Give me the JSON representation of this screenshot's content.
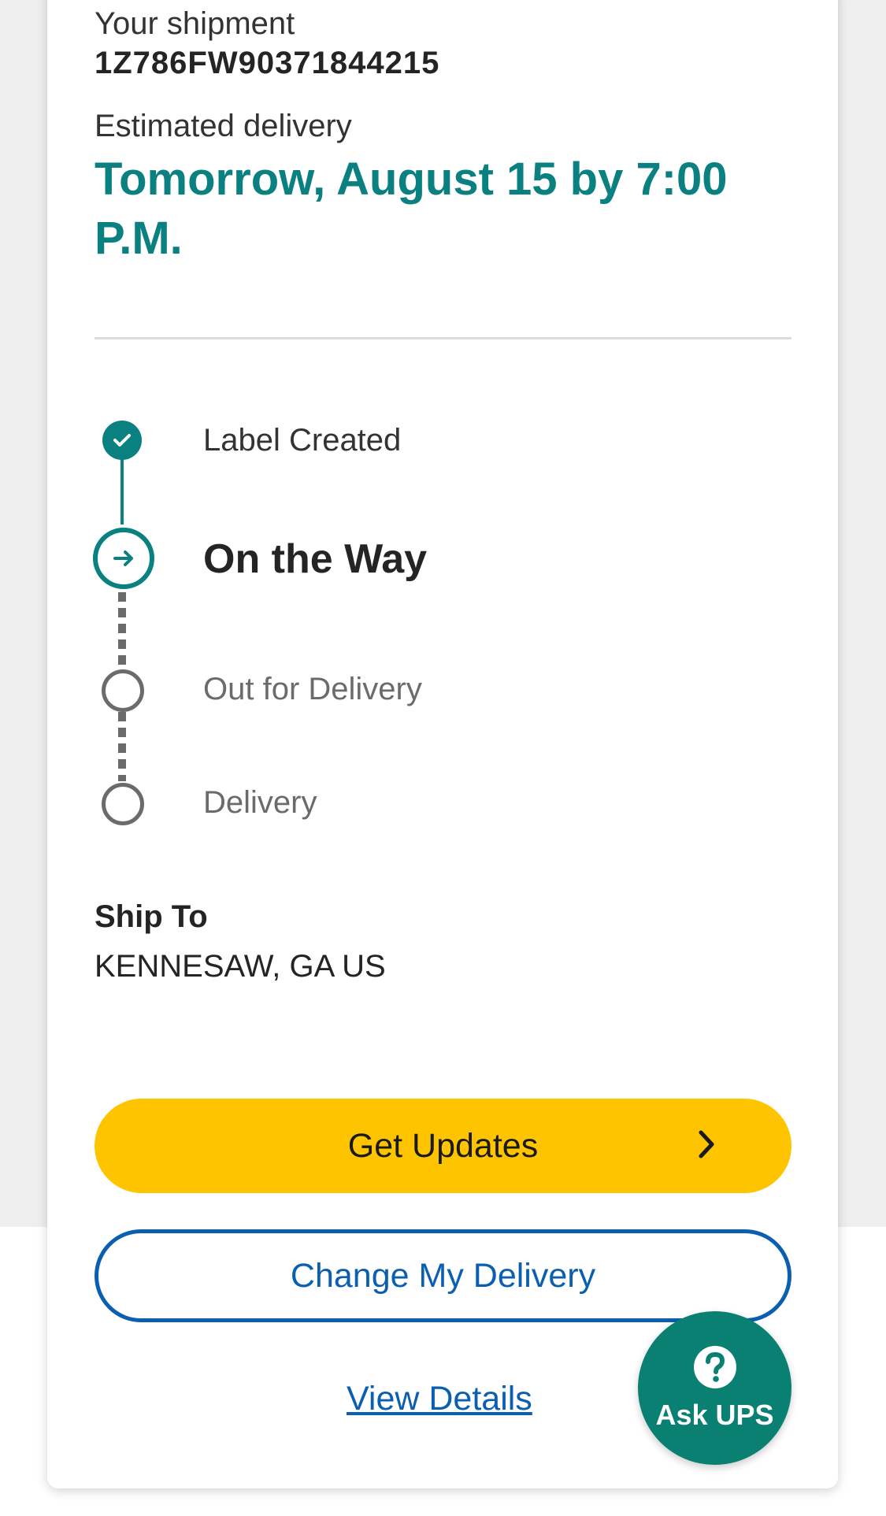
{
  "shipment": {
    "label": "Your shipment",
    "tracking_number": "1Z786FW90371844215"
  },
  "delivery": {
    "label": "Estimated delivery",
    "date_text": "Tomorrow, August 15 by 7:00 P.M."
  },
  "progress": {
    "steps": [
      {
        "label": "Label Created",
        "state": "done"
      },
      {
        "label": "On the Way",
        "state": "current"
      },
      {
        "label": "Out for Delivery",
        "state": "upcoming"
      },
      {
        "label": "Delivery",
        "state": "upcoming"
      }
    ]
  },
  "ship_to": {
    "label": "Ship To",
    "value": "KENNESAW, GA US"
  },
  "actions": {
    "get_updates": "Get Updates",
    "change_delivery": "Change My Delivery",
    "view_details": "View Details"
  },
  "help": {
    "label": "Ask UPS",
    "icon": "question-circle-icon"
  },
  "colors": {
    "teal": "#0a8080",
    "yellow": "#ffc400",
    "blue": "#0b5fb0",
    "gray": "#6b6b6b"
  }
}
